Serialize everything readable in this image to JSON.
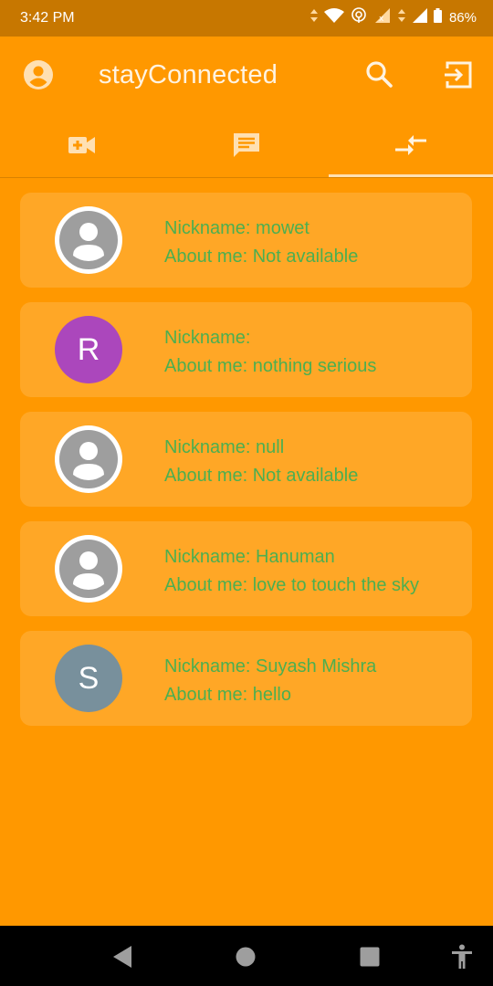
{
  "status_bar": {
    "time": "3:42 PM",
    "battery": "86%"
  },
  "app_bar": {
    "title": "stayConnected"
  },
  "tabs": [
    {
      "icon": "video-call-icon",
      "selected": false
    },
    {
      "icon": "chat-icon",
      "selected": false
    },
    {
      "icon": "compare-arrows-icon",
      "selected": true
    }
  ],
  "users": [
    {
      "nickname": "Nickname: mowet",
      "about": "About me: Not available",
      "avatar": {
        "type": "default"
      }
    },
    {
      "nickname": "Nickname: ",
      "about": "About me: nothing serious",
      "avatar": {
        "type": "letter",
        "letter": "R",
        "color": "#AB47BC"
      }
    },
    {
      "nickname": "Nickname: null",
      "about": "About me: Not available",
      "avatar": {
        "type": "default"
      }
    },
    {
      "nickname": "Nickname: Hanuman",
      "about": "About me: love to touch the sky",
      "avatar": {
        "type": "default"
      }
    },
    {
      "nickname": "Nickname: Suyash Mishra",
      "about": "About me: hello",
      "avatar": {
        "type": "letter",
        "letter": "S",
        "color": "#78909C"
      }
    }
  ],
  "colors": {
    "primary": "#FF9800",
    "card": "#FFA726",
    "text_green": "#4CAF50"
  }
}
